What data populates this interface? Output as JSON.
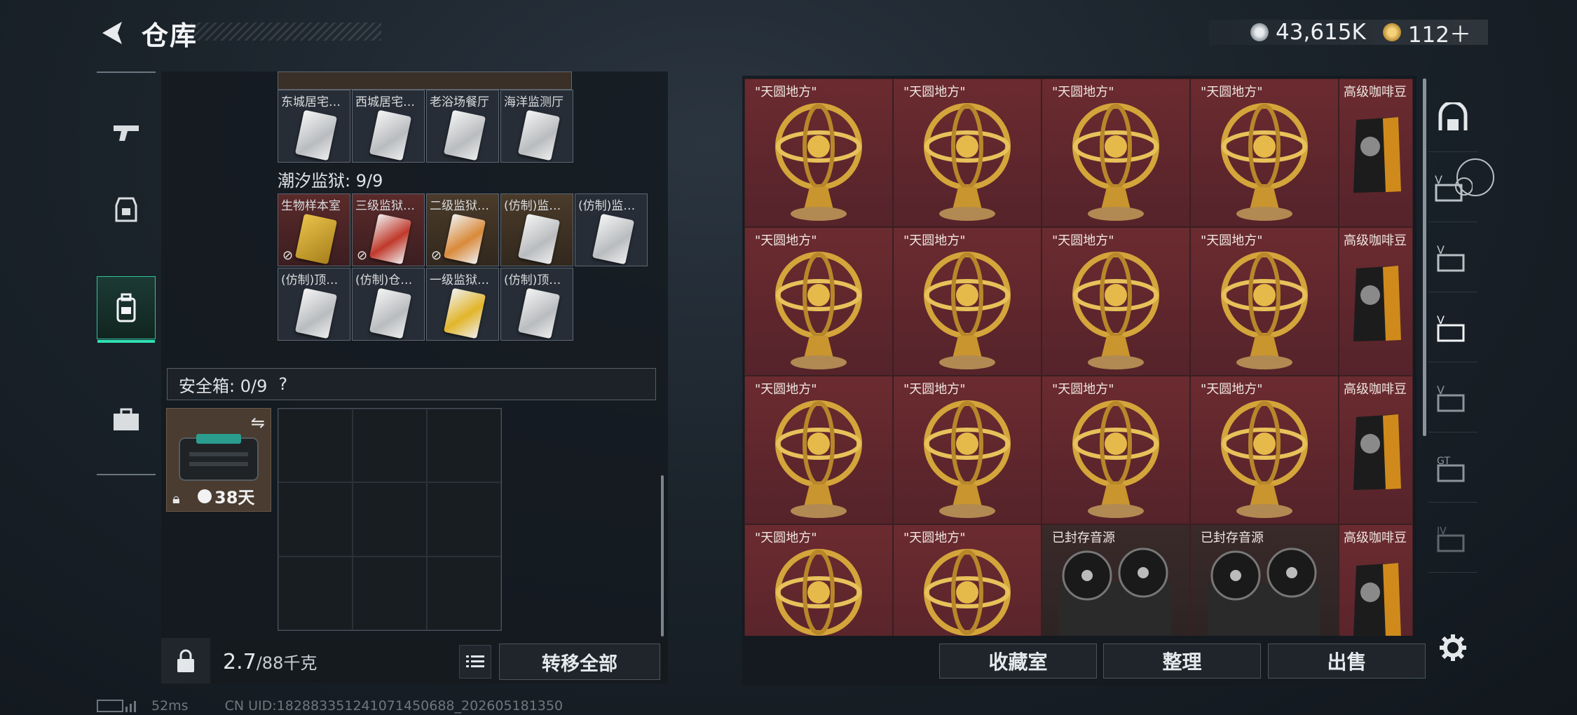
{
  "header": {
    "title": "仓库"
  },
  "currency": {
    "coins": "43,615K",
    "gems": "112＋"
  },
  "left_panel": {
    "row_top": [
      {
        "name": "东城居宅…"
      },
      {
        "name": "西城居宅…"
      },
      {
        "name": "老浴场餐厅"
      },
      {
        "name": "海洋监测厅"
      }
    ],
    "section_label": "潮汐监狱: 9/9",
    "prison_items": [
      {
        "name": "生物样本室",
        "bg": "red"
      },
      {
        "name": "三级监狱…",
        "bg": "red"
      },
      {
        "name": "二级监狱…",
        "bg": "brown"
      },
      {
        "name": "(仿制)监…",
        "bg": "brown"
      },
      {
        "name": "(仿制)监…",
        "bg": "normal"
      },
      {
        "name": "(仿制)顶…",
        "bg": "normal"
      },
      {
        "name": "(仿制)仓…",
        "bg": "normal"
      },
      {
        "name": "一级监狱…",
        "bg": "normal"
      },
      {
        "name": "(仿制)顶…",
        "bg": "normal"
      }
    ],
    "safe_box": {
      "label": "安全箱: 0/9",
      "help": "?",
      "timer": "38天"
    },
    "weight": {
      "current": "2.7",
      "max": "/88千克"
    },
    "transfer_all": "转移全部"
  },
  "stash": {
    "rows": [
      [
        "\"天圆地方\"",
        "\"天圆地方\"",
        "\"天圆地方\"",
        "\"天圆地方\"",
        "高级咖啡豆"
      ],
      [
        "\"天圆地方\"",
        "\"天圆地方\"",
        "\"天圆地方\"",
        "\"天圆地方\"",
        "高级咖啡豆"
      ],
      [
        "\"天圆地方\"",
        "\"天圆地方\"",
        "\"天圆地方\"",
        "\"天圆地方\"",
        "高级咖啡豆"
      ],
      [
        "\"天圆地方\"",
        "\"天圆地方\"",
        "已封存音源",
        "已封存音源",
        "高级咖啡豆"
      ]
    ]
  },
  "buttons": {
    "collection": "收藏室",
    "organize": "整理",
    "sell": "出售"
  },
  "status": {
    "ping": "52ms",
    "uid": "CN UID:1828833512410714506​88_202605181350"
  }
}
